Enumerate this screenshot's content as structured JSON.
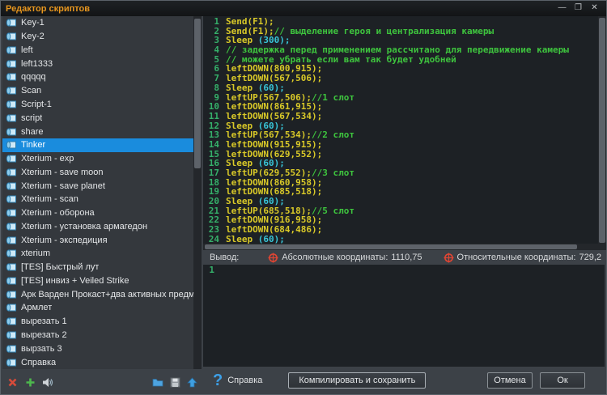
{
  "window": {
    "title": "Редактор скриптов",
    "controls": {
      "minimize": "—",
      "maximize": "❐",
      "close": "✕"
    }
  },
  "colors": {
    "title_text": "#e8971e",
    "selection": "#1a8cdd",
    "editor_bg": "#1d2125",
    "code_keyword": "#d9c928",
    "code_comment": "#3ec43e",
    "code_number": "#38c5d8",
    "line_number": "#35b06a",
    "crosshair": "#e04533",
    "help_icon": "#3da0e8"
  },
  "sidebar": {
    "items": [
      {
        "label": "Key-1"
      },
      {
        "label": "Key-2"
      },
      {
        "label": "left"
      },
      {
        "label": "left1333"
      },
      {
        "label": "qqqqq"
      },
      {
        "label": "Scan"
      },
      {
        "label": "Script-1"
      },
      {
        "label": "script"
      },
      {
        "label": "share"
      },
      {
        "label": "Tinker",
        "selected": true
      },
      {
        "label": "Xterium - exp"
      },
      {
        "label": "Xterium - save moon"
      },
      {
        "label": "Xterium - save planet"
      },
      {
        "label": "Xterium - scan"
      },
      {
        "label": "Xterium - оборона"
      },
      {
        "label": "Xterium - установка армагедон"
      },
      {
        "label": "Xterium - экспедиция"
      },
      {
        "label": "xterium"
      },
      {
        "label": "[TES] Быстрый лут"
      },
      {
        "label": "[TES] инвиз + Veiled Strike"
      },
      {
        "label": "Арк Варден Прокаст+два активных предмета"
      },
      {
        "label": "Армлет"
      },
      {
        "label": "вырезать 1"
      },
      {
        "label": "вырезать 2"
      },
      {
        "label": "вырзать 3"
      },
      {
        "label": "Справка"
      }
    ],
    "toolbar_icons": [
      "delete-icon",
      "add-icon",
      "sound-icon",
      "folder-icon",
      "save-icon",
      "upload-icon"
    ]
  },
  "editor": {
    "lines": [
      {
        "n": 1,
        "s": [
          {
            "c": "k",
            "t": "Send(F1);"
          }
        ]
      },
      {
        "n": 2,
        "s": [
          {
            "c": "k",
            "t": "Send(F1);"
          },
          {
            "c": "c",
            "t": "// выделение героя и централизация камеры"
          }
        ]
      },
      {
        "n": 3,
        "s": [
          {
            "c": "k",
            "t": "Sleep "
          },
          {
            "c": "n",
            "t": "(300);"
          }
        ]
      },
      {
        "n": 4,
        "s": [
          {
            "c": "c",
            "t": "// задержка перед применением рассчитано для передвижение камеры"
          }
        ]
      },
      {
        "n": 5,
        "s": [
          {
            "c": "c",
            "t": "// можете убрать если вам так будет удобней"
          }
        ]
      },
      {
        "n": 6,
        "s": [
          {
            "c": "k",
            "t": "leftDOWN(800,915);"
          }
        ]
      },
      {
        "n": 7,
        "s": [
          {
            "c": "k",
            "t": "leftDOWN(567,506);"
          }
        ]
      },
      {
        "n": 8,
        "s": [
          {
            "c": "k",
            "t": "Sleep "
          },
          {
            "c": "n",
            "t": "(60);"
          }
        ]
      },
      {
        "n": 9,
        "s": [
          {
            "c": "k",
            "t": "leftUP(567,506);"
          },
          {
            "c": "c",
            "t": "//1 слот"
          }
        ]
      },
      {
        "n": 10,
        "s": [
          {
            "c": "k",
            "t": "leftDOWN(861,915);"
          }
        ]
      },
      {
        "n": 11,
        "s": [
          {
            "c": "k",
            "t": "leftDOWN(567,534);"
          }
        ]
      },
      {
        "n": 12,
        "s": [
          {
            "c": "k",
            "t": "Sleep "
          },
          {
            "c": "n",
            "t": "(60);"
          }
        ]
      },
      {
        "n": 13,
        "s": [
          {
            "c": "k",
            "t": "leftUP(567,534);"
          },
          {
            "c": "c",
            "t": "//2 слот"
          }
        ]
      },
      {
        "n": 14,
        "s": [
          {
            "c": "k",
            "t": "leftDOWN(915,915);"
          }
        ]
      },
      {
        "n": 15,
        "s": [
          {
            "c": "k",
            "t": "leftDOWN(629,552);"
          }
        ]
      },
      {
        "n": 16,
        "s": [
          {
            "c": "k",
            "t": "Sleep "
          },
          {
            "c": "n",
            "t": "(60);"
          }
        ]
      },
      {
        "n": 17,
        "s": [
          {
            "c": "k",
            "t": "leftUP(629,552);"
          },
          {
            "c": "c",
            "t": "//3 слот"
          }
        ]
      },
      {
        "n": 18,
        "s": [
          {
            "c": "k",
            "t": "leftDOWN(860,958);"
          }
        ]
      },
      {
        "n": 19,
        "s": [
          {
            "c": "k",
            "t": "leftDOWN(685,518);"
          }
        ]
      },
      {
        "n": 20,
        "s": [
          {
            "c": "k",
            "t": "Sleep "
          },
          {
            "c": "n",
            "t": "(60);"
          }
        ]
      },
      {
        "n": 21,
        "s": [
          {
            "c": "k",
            "t": "leftUP(685,518);"
          },
          {
            "c": "c",
            "t": "//5 слот"
          }
        ]
      },
      {
        "n": 22,
        "s": [
          {
            "c": "k",
            "t": "leftDOWN(916,958);"
          }
        ]
      },
      {
        "n": 23,
        "s": [
          {
            "c": "k",
            "t": "leftDOWN(684,486);"
          }
        ]
      },
      {
        "n": 24,
        "s": [
          {
            "c": "k",
            "t": "Sleep "
          },
          {
            "c": "n",
            "t": "(60);"
          }
        ]
      }
    ]
  },
  "output": {
    "label": "Вывод:",
    "abs_label": "Абсолютные координаты:",
    "abs_value": "1110,75",
    "rel_label": "Относительные координаты:",
    "rel_value": "729,2",
    "line_num": "1"
  },
  "footer": {
    "help_label": "Справка",
    "compile_button": "Компилировать и сохранить",
    "cancel_button": "Отмена",
    "ok_button": "Ок"
  }
}
